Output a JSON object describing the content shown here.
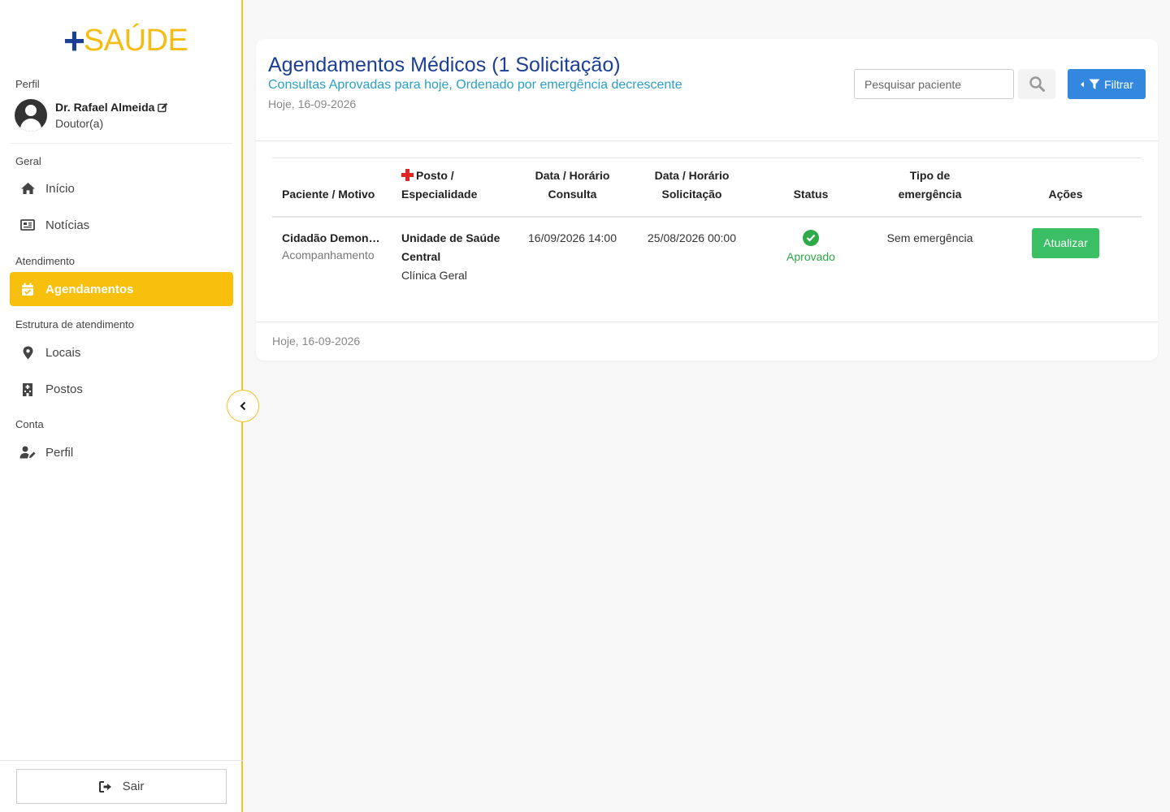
{
  "brand": {
    "plus": "+",
    "word": "SAÚDE",
    "primary_color": "#1b3f94",
    "accent_color": "#f5bd14"
  },
  "sidebar": {
    "profile_label": "Perfil",
    "user_name": "Dr. Rafael Almeida",
    "user_role": "Doutor(a)",
    "sections": {
      "geral": "Geral",
      "atendimento": "Atendimento",
      "estrutura": "Estrutura de atendimento",
      "conta": "Conta"
    },
    "items": [
      {
        "label": "Início",
        "icon": "home-icon"
      },
      {
        "label": "Notícias",
        "icon": "newspaper-icon"
      },
      {
        "label": "Agendamentos",
        "icon": "calendar-check-icon",
        "active": true
      },
      {
        "label": "Locais",
        "icon": "map-pin-icon"
      },
      {
        "label": "Postos",
        "icon": "hospital-building-icon"
      },
      {
        "label": "Perfil",
        "icon": "user-edit-icon"
      }
    ],
    "logout_label": "Sair"
  },
  "header": {
    "title": "Agendamentos Médicos (1 Solicitação)",
    "subtitle": "Consultas Aprovadas para hoje, Ordenado por emergência decrescente",
    "date": "Hoje, 16-09-2026",
    "search_placeholder": "Pesquisar paciente",
    "filter_label": "Filtrar"
  },
  "table": {
    "headers": {
      "patient": "Paciente / Motivo",
      "post": "Posto / Especialidade",
      "consult_date": "Data / Horário Consulta",
      "request_date": "Data / Horário Solicitação",
      "status": "Status",
      "emergency": "Tipo de emergência",
      "actions": "Ações"
    },
    "rows": [
      {
        "patient_name": "Cidadão Demonstração",
        "motive": "Acompanhamento",
        "unit": "Unidade de Saúde Central",
        "specialty": "Clínica Geral",
        "consult_datetime": "16/09/2026 14:00",
        "request_datetime": "25/08/2026 00:00",
        "status": "Aprovado",
        "emergency": "Sem emergência",
        "action_label": "Atualizar"
      }
    ]
  },
  "footer": {
    "date": "Hoje, 16-09-2026"
  }
}
